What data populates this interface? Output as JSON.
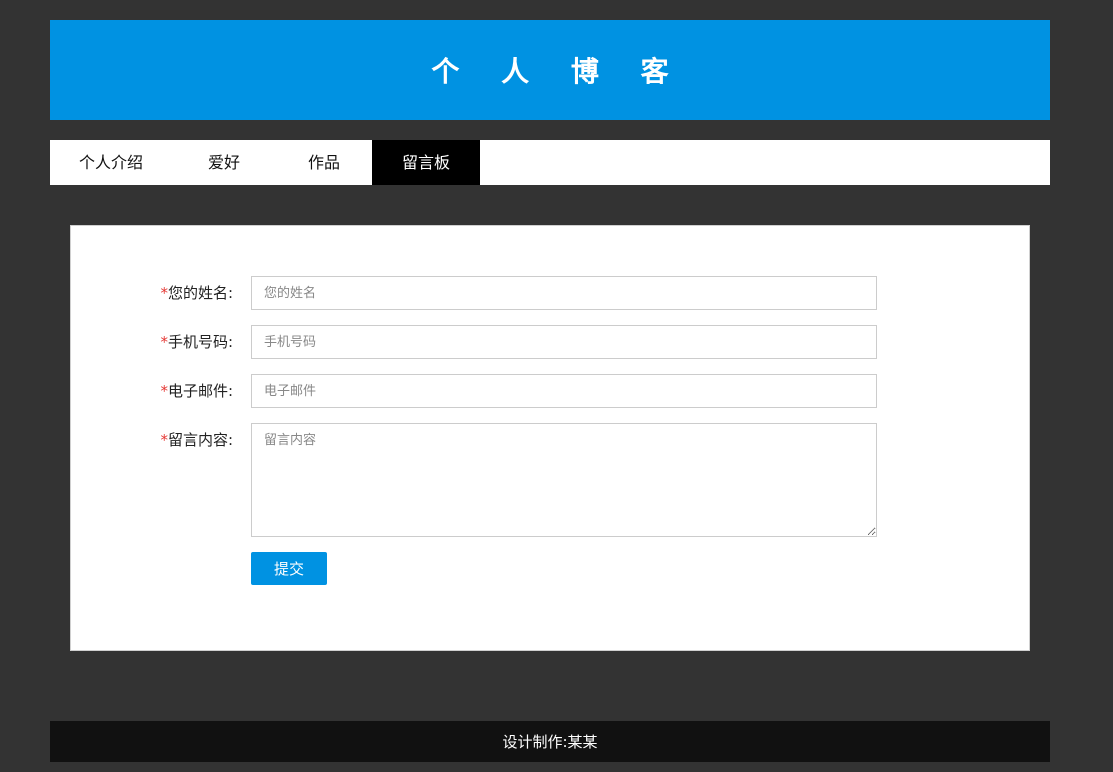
{
  "header": {
    "title": "个 人 博 客"
  },
  "nav": {
    "items": [
      {
        "label": "个人介绍",
        "active": false
      },
      {
        "label": "爱好",
        "active": false
      },
      {
        "label": "作品",
        "active": false
      },
      {
        "label": "留言板",
        "active": true
      }
    ]
  },
  "form": {
    "required_mark": "*",
    "name": {
      "label": "您的姓名:",
      "placeholder": "您的姓名",
      "value": ""
    },
    "phone": {
      "label": "手机号码:",
      "placeholder": "手机号码",
      "value": ""
    },
    "email": {
      "label": "电子邮件:",
      "placeholder": "电子邮件",
      "value": ""
    },
    "message": {
      "label": "留言内容:",
      "placeholder": "留言内容",
      "value": ""
    },
    "submit_label": "提交"
  },
  "footer": {
    "text": "设计制作:某某"
  },
  "colors": {
    "background": "#333333",
    "header": "#0092e2",
    "nav_active": "#000000",
    "accent": "#0092e2",
    "required": "#e53935",
    "footer": "#111111"
  }
}
